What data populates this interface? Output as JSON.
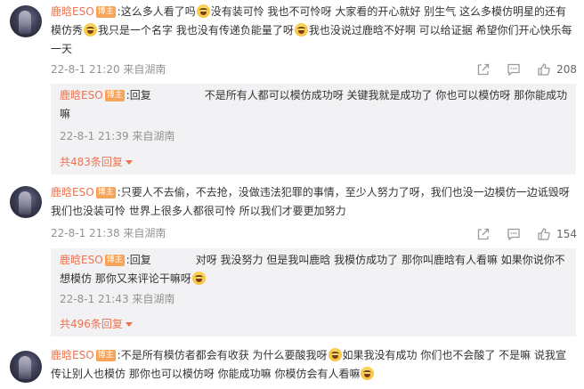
{
  "comments": [
    {
      "user": "鹿晗ESO",
      "badge": "博主",
      "text_a": ":这么多人看了吗",
      "text_b": "没有装可怜 我也不可怜呀 大家看的开心就好 别生气  这么多模仿明星的还有模仿秀",
      "text_c": "我只是一个名字 我也没有传递负能量了呀",
      "text_d": "我也没说过鹿晗不好啊 可以给证据 希望你们开心快乐每一天",
      "meta": "22-8-1 21:20 来自湖南",
      "likes": "208",
      "reply": {
        "user": "鹿晗ESO",
        "badge": "博主",
        "prefix": ":回复",
        "text": "不是所有人都可以模仿成功呀 关键我就是成功了 你也可以模仿呀 那你能成功嘛",
        "meta": "22-8-1 21:39 来自湖南"
      },
      "more": "共483条回复"
    },
    {
      "user": "鹿晗ESO",
      "badge": "博主",
      "text_a": ":只要人不去偷，不去抢，没做违法犯罪的事情，至少人努力了呀，我们也没一边模仿一边诋毁呀 我们也没装可怜 世界上很多人都很可怜 所以我们才要更加努力",
      "meta": "22-8-1 21:38 来自湖南",
      "likes": "154",
      "reply": {
        "user": "鹿晗ESO",
        "badge": "博主",
        "prefix": ":回复",
        "text": "对呀 我没努力 但是我叫鹿晗 我模仿成功了 那你叫鹿晗有人看嘛 如果你说你不想模仿 那你又来评论干嘛呀",
        "meta": "22-8-1 21:43 来自湖南"
      },
      "more": "共496条回复"
    },
    {
      "user": "鹿晗ESO",
      "badge": "博主",
      "text_a": ":不是所有模仿者都会有收获  为什么要酸我呀",
      "text_b": "如果我没有成功 你们也不会酸了 不是嘛 说我宣传让别人也模仿 那你也可以模仿呀 你能成功嘛 你模仿会有人看嘛"
    }
  ],
  "icons": {
    "share": "share-icon",
    "comment": "comment-icon",
    "like": "like-icon",
    "emoji": "laugh-cry-emoji-icon"
  },
  "colors": {
    "username": "#eb7350",
    "badge": "#f7a45b",
    "meta": "#939393",
    "reply_bg": "#f2f2f5"
  }
}
